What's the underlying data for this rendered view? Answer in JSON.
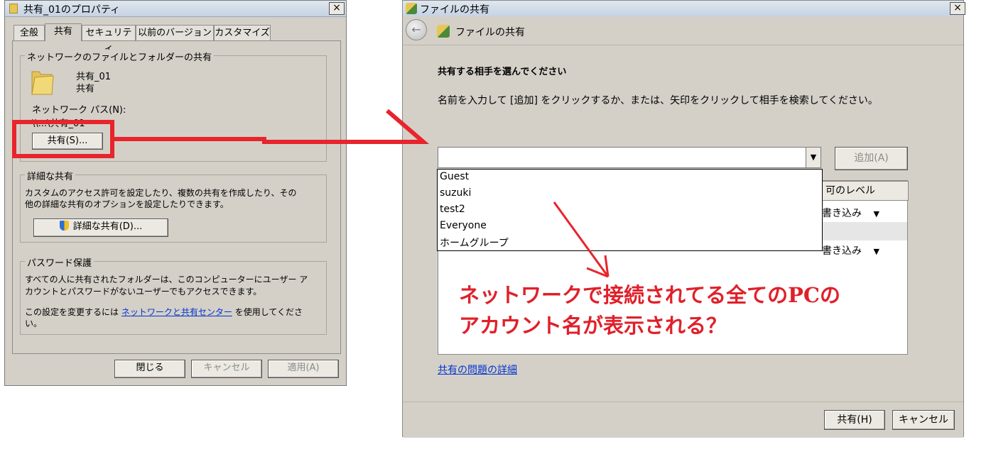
{
  "left_dialog": {
    "title": "共有_01のプロパティ",
    "close": "×",
    "tabs": [
      {
        "label": "全般"
      },
      {
        "label": "共有"
      },
      {
        "label": "セキュリティ"
      },
      {
        "label": "以前のバージョン"
      },
      {
        "label": "カスタマイズ"
      }
    ],
    "network_group": {
      "legend": "ネットワークのファイルとフォルダーの共有",
      "folder_name": "共有_01",
      "folder_status": "共有",
      "path_label": "ネットワーク パス(N):",
      "path_value": "\\\\...\\共有_01",
      "share_button": "共有(S)..."
    },
    "advanced_group": {
      "legend": "詳細な共有",
      "desc_line1": "カスタムのアクセス許可を設定したり、複数の共有を作成したり、その",
      "desc_line2": "他の詳細な共有のオプションを設定したりできます。",
      "button": "詳細な共有(D)..."
    },
    "password_group": {
      "legend": "パスワード保護",
      "line1": "すべての人に共有されたフォルダーは、このコンピューターにユーザー ア",
      "line2": "カウントとパスワードがないユーザーでもアクセスできます。",
      "line3_prefix": "この設定を変更するには",
      "line3_link": "ネットワークと共有センター",
      "line3_suffix": "を使用してくださ",
      "line4": "い。"
    },
    "buttons": {
      "close": "閉じる",
      "cancel": "キャンセル",
      "apply": "適用(A)"
    }
  },
  "right_dialog": {
    "title": "ファイルの共有",
    "close": "×",
    "nav_title": "ファイルの共有",
    "heading": "共有する相手を選んでください",
    "instruction": "名前を入力して [追加] をクリックするか、または、矢印をクリックして相手を検索してください。",
    "combo_value": "",
    "add_button": "追加(A)",
    "column_level": "可のレベル",
    "row_levels": [
      "書き込み",
      "書き込み"
    ],
    "dropdown_items": [
      "Guest",
      "suzuki",
      "test2",
      "Everyone",
      "ホームグループ"
    ],
    "help_link": "共有の問題の詳細",
    "share_button": "共有(H)",
    "cancel_button": "キャンセル"
  },
  "annotation": {
    "line1": "ネットワークで接続されてる全てのPCの",
    "line2": "アカウント名が表示される？",
    "color": "#e0202a"
  }
}
